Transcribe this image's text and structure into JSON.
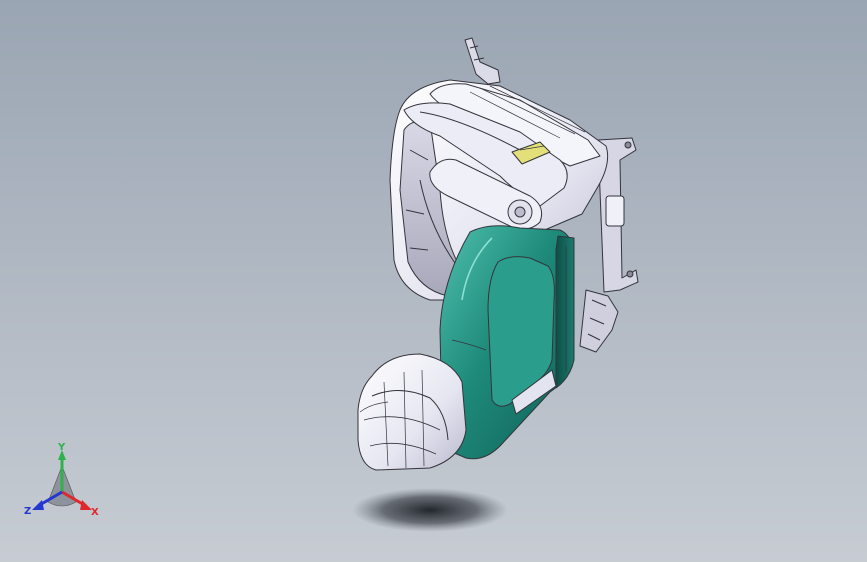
{
  "viewport": {
    "background_top": "#9aa5b3",
    "background_bottom": "#c7ccd3"
  },
  "model": {
    "body_color": "#1e8a7a",
    "body_dark": "#0f5f55",
    "shell_color": "#e9e9f3",
    "shell_edge": "#34343c",
    "button_color": "#e3e07a"
  },
  "triad": {
    "labels": {
      "x": "X",
      "y": "Y",
      "z": "Z"
    },
    "colors": {
      "x": "#e0282c",
      "y": "#2fb24a",
      "z": "#2437d0"
    }
  }
}
